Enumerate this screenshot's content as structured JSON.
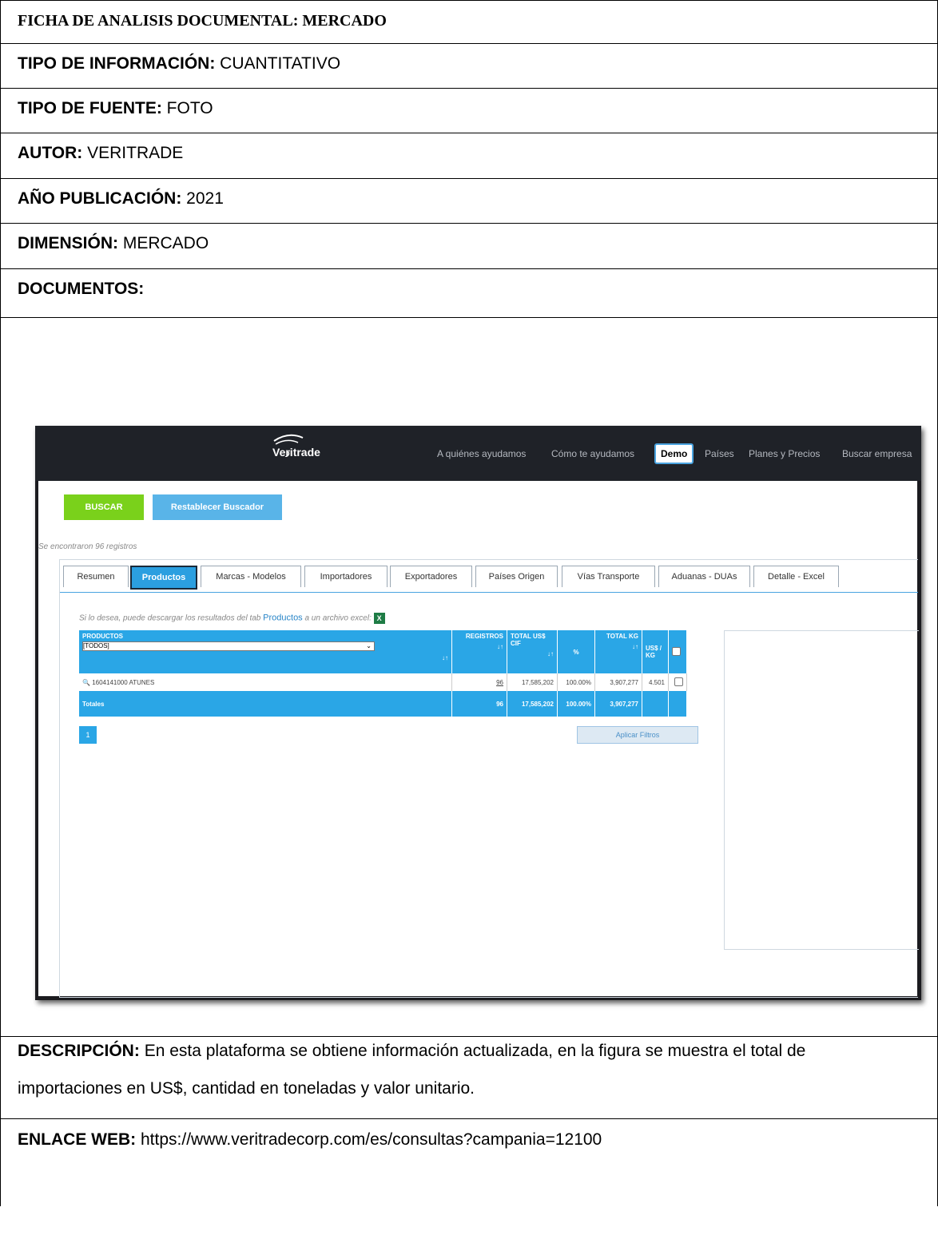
{
  "form": {
    "title": "FICHA DE ANALISIS DOCUMENTAL: MERCADO",
    "tipo_info_label": "TIPO DE INFORMACIÓN:",
    "tipo_info_value": " CUANTITATIVO",
    "tipo_fuente_label": "TIPO DE FUENTE:",
    "tipo_fuente_value": " FOTO",
    "autor_label": "AUTOR:",
    "autor_value": " VERITRADE",
    "anio_label": "AÑO PUBLICACIÓN:",
    "anio_value": " 2021",
    "dimension_label": "DIMENSIÓN:",
    "dimension_value": " MERCADO",
    "documentos_label": "DOCUMENTOS:",
    "descripcion_label": "DESCRIPCIÓN:",
    "descripcion_line1": " En esta plataforma se obtiene información actualizada, en la figura se muestra el total de",
    "descripcion_line2": "importaciones en US$, cantidad en toneladas y valor unitario.",
    "enlace_label": "ENLACE WEB:",
    "enlace_value": " https://www.veritradecorp.com/es/consultas?campania=12100"
  },
  "screenshot": {
    "logo": "Veritrade",
    "nav": [
      "A quiénes ayudamos",
      "Cómo te ayudamos",
      "Demo",
      "Países",
      "Planes y Precios",
      "Buscar empresa"
    ],
    "buscar": "BUSCAR",
    "restablecer": "Restablecer Buscador",
    "found": "Se encontraron 96 registros",
    "tabs": [
      "Resumen",
      "Productos",
      "Marcas - Modelos",
      "Importadores",
      "Exportadores",
      "Países Origen",
      "Vías Transporte",
      "Aduanas - DUAs",
      "Detalle - Excel"
    ],
    "hint_pre": "Si lo desea, puede descargar los resultados del tab ",
    "hint_link": "Productos",
    "hint_post": " a un archivo excel:",
    "xls_label": "X",
    "table": {
      "h_productos": "PRODUCTOS",
      "select_value": "[TODOS]",
      "h_registros": "REGISTROS",
      "h_total_cif": "TOTAL US$ CIF",
      "h_pct": "%",
      "h_total_kg": "TOTAL KG",
      "h_usd_kg": "US$ / KG",
      "sort": "↓↑",
      "row": {
        "producto": "1604141000 ATUNES",
        "registros": "96",
        "cif": "17,585,202",
        "pct": "100.00%",
        "kg": "3,907,277",
        "usd_kg": "4.501"
      },
      "totals": {
        "label": "Totales",
        "registros": "96",
        "cif": "17,585,202",
        "pct": "100.00%",
        "kg": "3,907,277"
      }
    },
    "page": "1",
    "apply": "Aplicar Filtros"
  }
}
